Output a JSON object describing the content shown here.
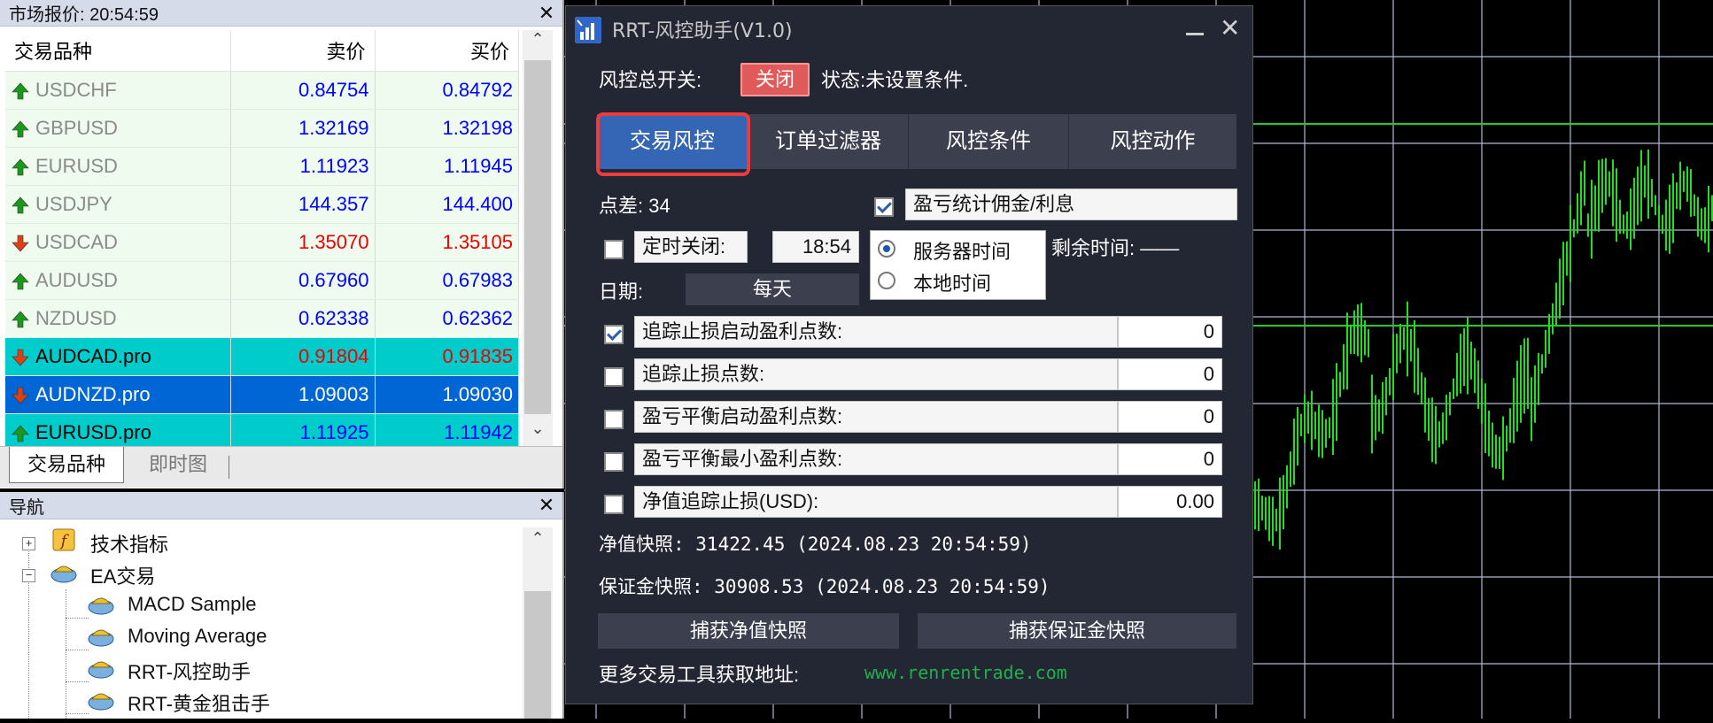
{
  "market_watch": {
    "title": "市场报价: 20:54:59",
    "columns": [
      "交易品种",
      "卖价",
      "买价"
    ],
    "rows": [
      {
        "symbol": "USDCHF",
        "bid": "0.84754",
        "ask": "0.84792",
        "direction": "up",
        "style": "light"
      },
      {
        "symbol": "GBPUSD",
        "bid": "1.32169",
        "ask": "1.32198",
        "direction": "up",
        "style": "light"
      },
      {
        "symbol": "EURUSD",
        "bid": "1.11923",
        "ask": "1.11945",
        "direction": "up",
        "style": "light"
      },
      {
        "symbol": "USDJPY",
        "bid": "144.357",
        "ask": "144.400",
        "direction": "up",
        "style": "light"
      },
      {
        "symbol": "USDCAD",
        "bid": "1.35070",
        "ask": "1.35105",
        "direction": "down",
        "style": "light"
      },
      {
        "symbol": "AUDUSD",
        "bid": "0.67960",
        "ask": "0.67983",
        "direction": "up",
        "style": "light"
      },
      {
        "symbol": "NZDUSD",
        "bid": "0.62338",
        "ask": "0.62362",
        "direction": "up",
        "style": "light"
      },
      {
        "symbol": "AUDCAD.pro",
        "bid": "0.91804",
        "ask": "0.91835",
        "direction": "down",
        "style": "cyan"
      },
      {
        "symbol": "AUDNZD.pro",
        "bid": "1.09003",
        "ask": "1.09030",
        "direction": "down",
        "style": "sel"
      },
      {
        "symbol": "EURUSD.pro",
        "bid": "1.11925",
        "ask": "1.11942",
        "direction": "up",
        "style": "cyan"
      }
    ],
    "tabs": [
      "交易品种",
      "即时图"
    ]
  },
  "navigator": {
    "title": "导航",
    "items": [
      "技术指标",
      "EA交易",
      "MACD Sample",
      "Moving Average",
      "RRT-风控助手",
      "RRT-黄金狙击手"
    ]
  },
  "dialog": {
    "title": "RRT-风控助手(V1.0)",
    "master_switch_label": "风控总开关:",
    "off_button": "关闭",
    "status": "状态:未设置条件.",
    "tabs": [
      "交易风控",
      "订单过滤器",
      "风控条件",
      "风控动作"
    ],
    "spread": "点差: 34",
    "include_commission_label": "盈亏统计佣金/利息",
    "include_commission_checked": true,
    "timed_close_label": "定时关闭:",
    "timed_close_checked": false,
    "timed_close_time": "18:54",
    "time_options": [
      "服务器时间",
      "本地时间"
    ],
    "time_selected": 0,
    "remaining_label": "剩余时间: ——",
    "date_label": "日期:",
    "date_value": "每天",
    "params": [
      {
        "label": "追踪止损启动盈利点数:",
        "value": "0",
        "checked": true
      },
      {
        "label": "追踪止损点数:",
        "value": "0",
        "checked": false
      },
      {
        "label": "盈亏平衡启动盈利点数:",
        "value": "0",
        "checked": false
      },
      {
        "label": "盈亏平衡最小盈利点数:",
        "value": "0",
        "checked": false
      },
      {
        "label": "净值追踪止损(USD):",
        "value": "0.00",
        "checked": false
      }
    ],
    "equity_snapshot": "净值快照: 31422.45 (2024.08.23 20:54:59)",
    "margin_snapshot": "保证金快照: 30908.53 (2024.08.23 20:54:59)",
    "capture_equity_button": "捕获净值快照",
    "capture_margin_button": "捕获保证金快照",
    "more_tools_label": "更多交易工具获取地址:",
    "more_tools_url": "www.renrentrade.com"
  },
  "colors": {
    "accent_tab": "#3566b5",
    "off_button": "#e05a5a",
    "chart_bars": "#22dd22",
    "chart_grid": "#b0b8d8",
    "chart_level": "#22cc22"
  }
}
